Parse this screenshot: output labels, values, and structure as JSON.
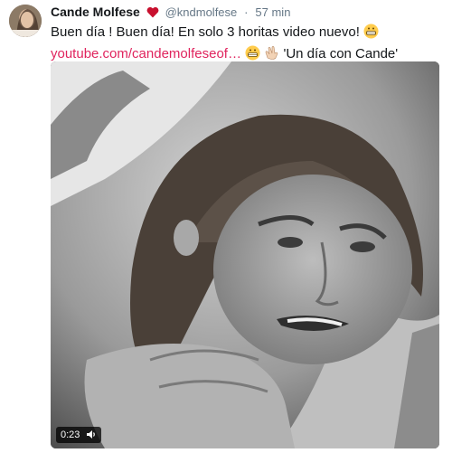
{
  "tweet": {
    "author_name": "Cande Molfese",
    "handle": "@kndmolfese",
    "separator": "·",
    "time": "57 min",
    "text_line1": "Buen día ! Buen día! En solo 3 horitas video nuevo!",
    "link": "youtube.com/candemolfeseof…",
    "text_line2_suffix": "'Un día con Cande'"
  },
  "media": {
    "duration": "0:23"
  },
  "colors": {
    "link": "#e0245e",
    "heart": "#c8102e",
    "meta": "#657786"
  },
  "icons": [
    "heart-icon",
    "grinning-emoji-icon",
    "clapping-hands-emoji-icon",
    "volume-icon"
  ]
}
